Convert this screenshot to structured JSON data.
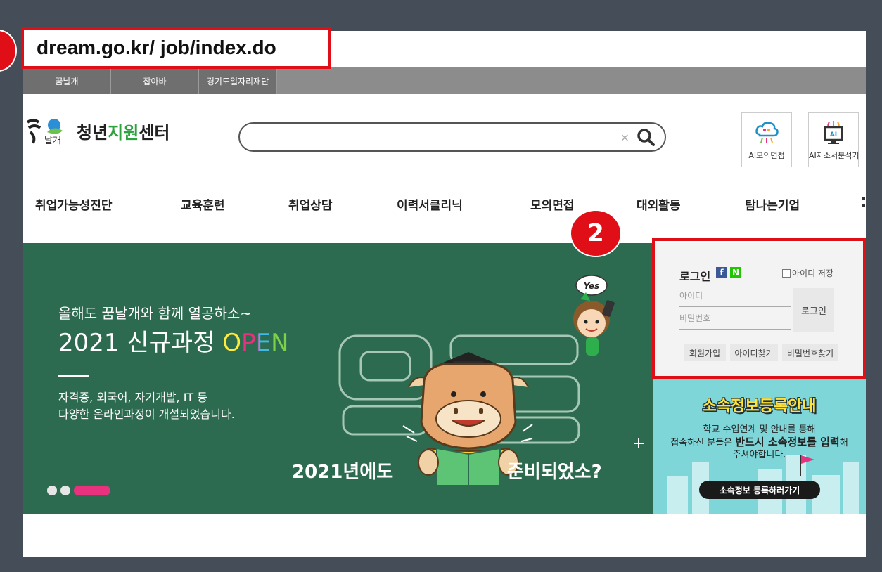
{
  "url": "dream.go.kr/ job/index.do",
  "site_tabs": [
    "꿈날개",
    "잡아바",
    "경기도일자리재단"
  ],
  "logo": {
    "mark_text": "날개",
    "name_prefix": "청년",
    "name_green": "지원",
    "name_suffix": "센터"
  },
  "search": {
    "value": "",
    "clear": "×"
  },
  "tools": [
    {
      "label": "AI모의면접",
      "icon": "ai-interview-icon"
    },
    {
      "label": "AI자소서분석기",
      "icon": "ai-resume-analyzer-icon"
    }
  ],
  "nav": [
    "취업가능성진단",
    "교육훈련",
    "취업상담",
    "이력서클리닉",
    "모의면접",
    "대외활동",
    "탐나는기업"
  ],
  "banner": {
    "line1": "올해도 꿈날개와 함께 열공하소~",
    "line2_main": "2021 신규과정 ",
    "line2_open": "OPEN",
    "sub1": "자격증, 외국어, 자기개발, IT 등",
    "sub2": "다양한 온라인과정이 개설되었습니다.",
    "slogan_left": "2021년에도",
    "slogan_right": "준비되었소?",
    "bubble": "Yes",
    "deco_text": "열공",
    "slide_count": 3,
    "active_slide": 3
  },
  "marker": {
    "two": "2"
  },
  "login": {
    "title": "로그인",
    "sns": [
      "f",
      "N"
    ],
    "save_id": "아이디 저장",
    "id_placeholder": "아이디",
    "pw_placeholder": "비밀번호",
    "button": "로그인",
    "signup": "회원가입",
    "find_id": "아이디찾기",
    "find_pw": "비밀번호찾기"
  },
  "notice": {
    "title": "소속정보등록안내",
    "line1": "학교 수업연계 및 안내를 통해",
    "line2_pre": "접속하신 분들은 ",
    "line2_bold": "반드시 소속정보를 입력",
    "line2_post": "해",
    "line3": "주셔야합니다.",
    "button": "소속정보 등록하러가기"
  },
  "colors": {
    "marker_red": "#e00f17",
    "banner_green": "#2d6b50",
    "notice_teal": "#7fd6d9",
    "accent_pink": "#e8327e"
  }
}
